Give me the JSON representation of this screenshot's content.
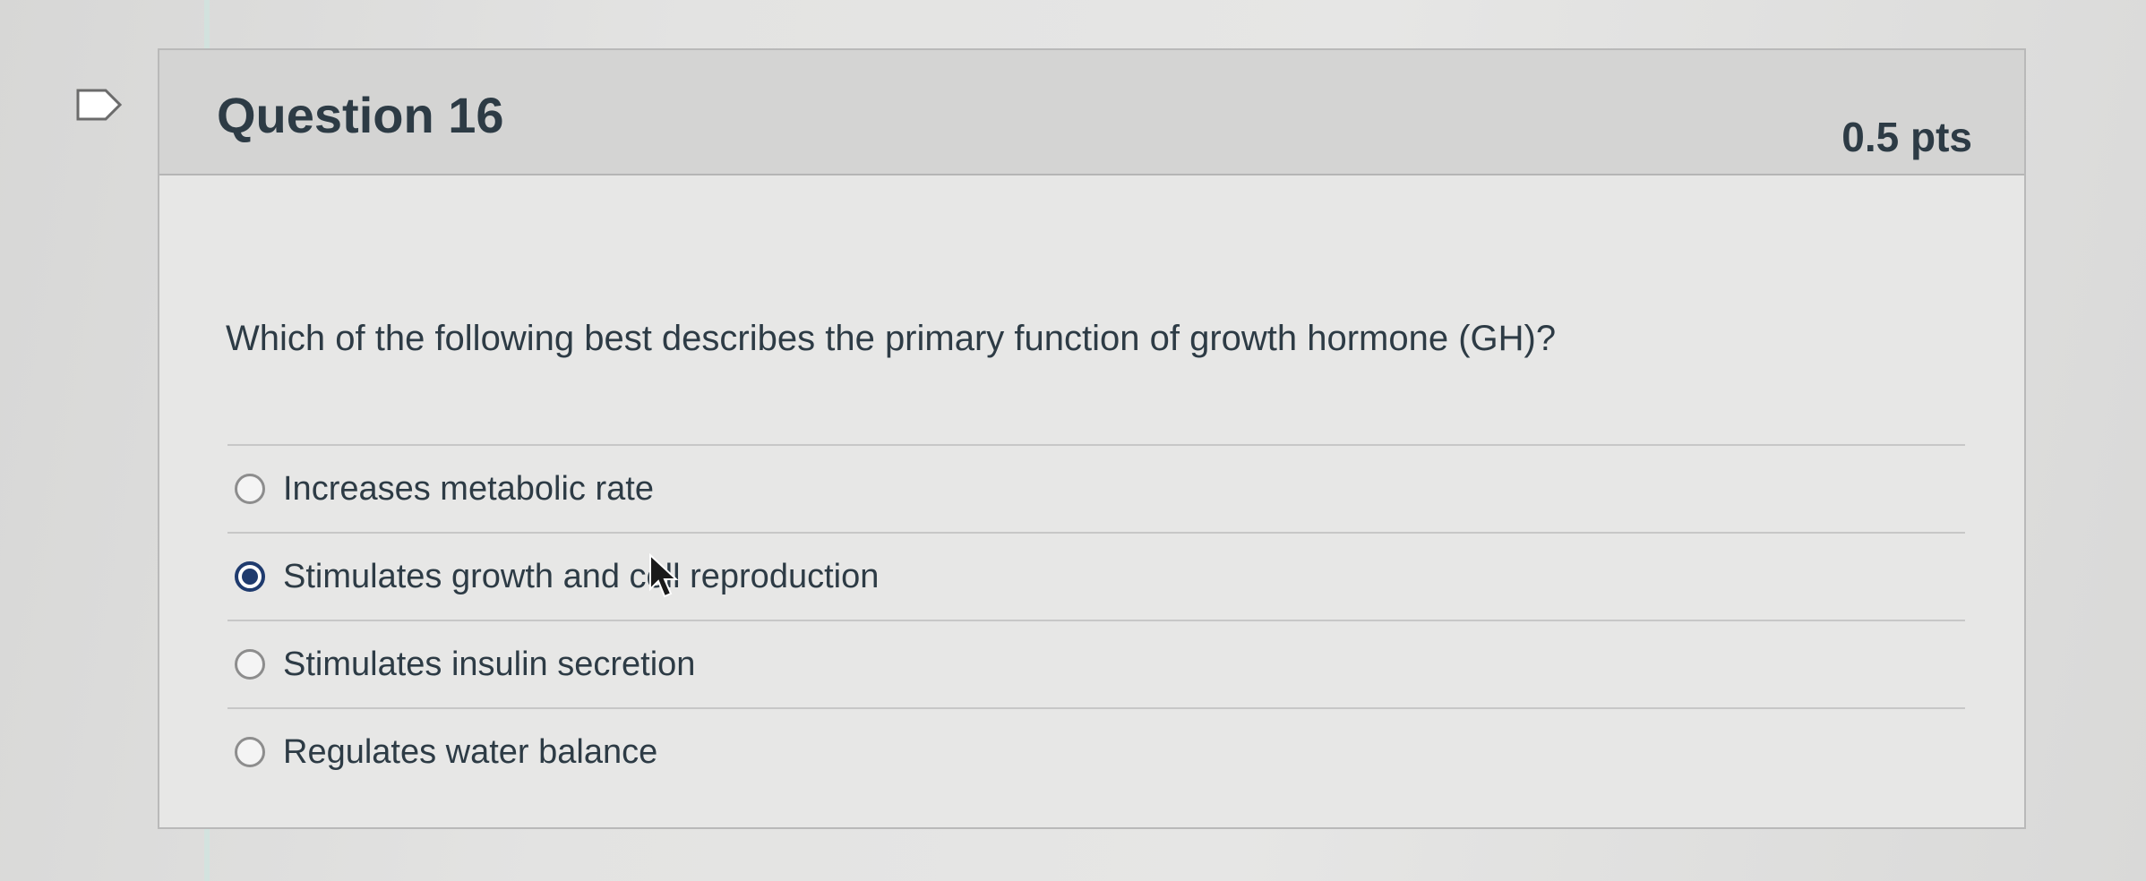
{
  "question": {
    "title": "Question 16",
    "points": "0.5 pts",
    "text": "Which of the following best describes the primary function of growth hormone (GH)?"
  },
  "answers": [
    {
      "label": "Increases metabolic rate",
      "selected": false
    },
    {
      "label": "Stimulates growth and cell reproduction",
      "selected": true
    },
    {
      "label": "Stimulates insulin secretion",
      "selected": false
    },
    {
      "label": "Regulates water balance",
      "selected": false
    }
  ],
  "icons": {
    "flag": "flag-icon",
    "cursor": "mouse-pointer-icon"
  },
  "colors": {
    "text": "#2d3b45",
    "header_bg": "#d4d4d3",
    "selected_radio": "#1f3b6e"
  }
}
